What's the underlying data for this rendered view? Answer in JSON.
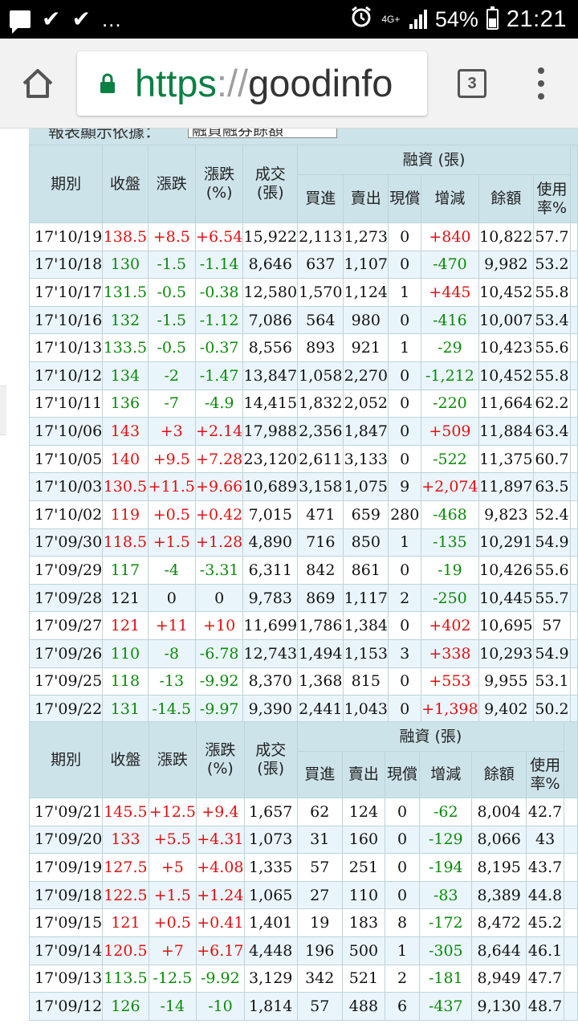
{
  "status_bar": {
    "left_icons": [
      "chat-icon",
      "check-icon",
      "check-icon",
      "more-dots-icon"
    ],
    "more": "...",
    "network": "4G+",
    "battery": "54%",
    "time": "21:21"
  },
  "browser": {
    "url_scheme": "https",
    "url_sep": "://",
    "url_host": "goodinfo",
    "tab_count": "3"
  },
  "partial_header": {
    "label": "報表顯示依據：",
    "select_value": "融資融券餘額"
  },
  "table_header": {
    "period": "期別",
    "close": "收盤",
    "change": "漲跌",
    "change_pct": "漲跌 (%)",
    "volume": "成交 (張)",
    "margin_group": "融資 (張)",
    "buy": "買進",
    "sell": "賣出",
    "cash_repay": "現償",
    "delta": "增減",
    "balance": "餘額",
    "usage": "使用率%"
  },
  "block1": [
    [
      "17'10/19",
      "138.5",
      "+8.5",
      "+6.54",
      "15,922",
      "2,113",
      "1,273",
      "0",
      "+840",
      "10,822",
      "57.7"
    ],
    [
      "17'10/18",
      "130",
      "-1.5",
      "-1.14",
      "8,646",
      "637",
      "1,107",
      "0",
      "-470",
      "9,982",
      "53.2"
    ],
    [
      "17'10/17",
      "131.5",
      "-0.5",
      "-0.38",
      "12,580",
      "1,570",
      "1,124",
      "1",
      "+445",
      "10,452",
      "55.8"
    ],
    [
      "17'10/16",
      "132",
      "-1.5",
      "-1.12",
      "7,086",
      "564",
      "980",
      "0",
      "-416",
      "10,007",
      "53.4"
    ],
    [
      "17'10/13",
      "133.5",
      "-0.5",
      "-0.37",
      "8,556",
      "893",
      "921",
      "1",
      "-29",
      "10,423",
      "55.6"
    ],
    [
      "17'10/12",
      "134",
      "-2",
      "-1.47",
      "13,847",
      "1,058",
      "2,270",
      "0",
      "-1,212",
      "10,452",
      "55.8"
    ],
    [
      "17'10/11",
      "136",
      "-7",
      "-4.9",
      "14,415",
      "1,832",
      "2,052",
      "0",
      "-220",
      "11,664",
      "62.2"
    ],
    [
      "17'10/06",
      "143",
      "+3",
      "+2.14",
      "17,988",
      "2,356",
      "1,847",
      "0",
      "+509",
      "11,884",
      "63.4"
    ],
    [
      "17'10/05",
      "140",
      "+9.5",
      "+7.28",
      "23,120",
      "2,611",
      "3,133",
      "0",
      "-522",
      "11,375",
      "60.7"
    ],
    [
      "17'10/03",
      "130.5",
      "+11.5",
      "+9.66",
      "10,689",
      "3,158",
      "1,075",
      "9",
      "+2,074",
      "11,897",
      "63.5"
    ],
    [
      "17'10/02",
      "119",
      "+0.5",
      "+0.42",
      "7,015",
      "471",
      "659",
      "280",
      "-468",
      "9,823",
      "52.4"
    ],
    [
      "17'09/30",
      "118.5",
      "+1.5",
      "+1.28",
      "4,890",
      "716",
      "850",
      "1",
      "-135",
      "10,291",
      "54.9"
    ],
    [
      "17'09/29",
      "117",
      "-4",
      "-3.31",
      "6,311",
      "842",
      "861",
      "0",
      "-19",
      "10,426",
      "55.6"
    ],
    [
      "17'09/28",
      "121",
      "0",
      "0",
      "9,783",
      "869",
      "1,117",
      "2",
      "-250",
      "10,445",
      "55.7"
    ],
    [
      "17'09/27",
      "121",
      "+11",
      "+10",
      "11,699",
      "1,786",
      "1,384",
      "0",
      "+402",
      "10,695",
      "57"
    ],
    [
      "17'09/26",
      "110",
      "-8",
      "-6.78",
      "12,743",
      "1,494",
      "1,153",
      "3",
      "+338",
      "10,293",
      "54.9"
    ],
    [
      "17'09/25",
      "118",
      "-13",
      "-9.92",
      "8,370",
      "1,368",
      "815",
      "0",
      "+553",
      "9,955",
      "53.1"
    ],
    [
      "17'09/22",
      "131",
      "-14.5",
      "-9.97",
      "9,390",
      "2,441",
      "1,043",
      "0",
      "+1,398",
      "9,402",
      "50.2"
    ]
  ],
  "block2": [
    [
      "17'09/21",
      "145.5",
      "+12.5",
      "+9.4",
      "1,657",
      "62",
      "124",
      "0",
      "-62",
      "8,004",
      "42.7"
    ],
    [
      "17'09/20",
      "133",
      "+5.5",
      "+4.31",
      "1,073",
      "31",
      "160",
      "0",
      "-129",
      "8,066",
      "43"
    ],
    [
      "17'09/19",
      "127.5",
      "+5",
      "+4.08",
      "1,335",
      "57",
      "251",
      "0",
      "-194",
      "8,195",
      "43.7"
    ],
    [
      "17'09/18",
      "122.5",
      "+1.5",
      "+1.24",
      "1,065",
      "27",
      "110",
      "0",
      "-83",
      "8,389",
      "44.8"
    ],
    [
      "17'09/15",
      "121",
      "+0.5",
      "+0.41",
      "1,401",
      "19",
      "183",
      "8",
      "-172",
      "8,472",
      "45.2"
    ],
    [
      "17'09/14",
      "120.5",
      "+7",
      "+6.17",
      "4,448",
      "196",
      "500",
      "1",
      "-305",
      "8,644",
      "46.1"
    ],
    [
      "17'09/13",
      "113.5",
      "-12.5",
      "-9.92",
      "3,129",
      "342",
      "521",
      "2",
      "-181",
      "8,949",
      "47.7"
    ],
    [
      "17'09/12",
      "126",
      "-14",
      "-10",
      "1,814",
      "57",
      "488",
      "6",
      "-437",
      "9,130",
      "48.7"
    ]
  ],
  "colors": {
    "up": "#e01010",
    "down": "#0a8a0a",
    "header_bg": "#cde3ea",
    "alt_row": "#eaf5fb"
  }
}
